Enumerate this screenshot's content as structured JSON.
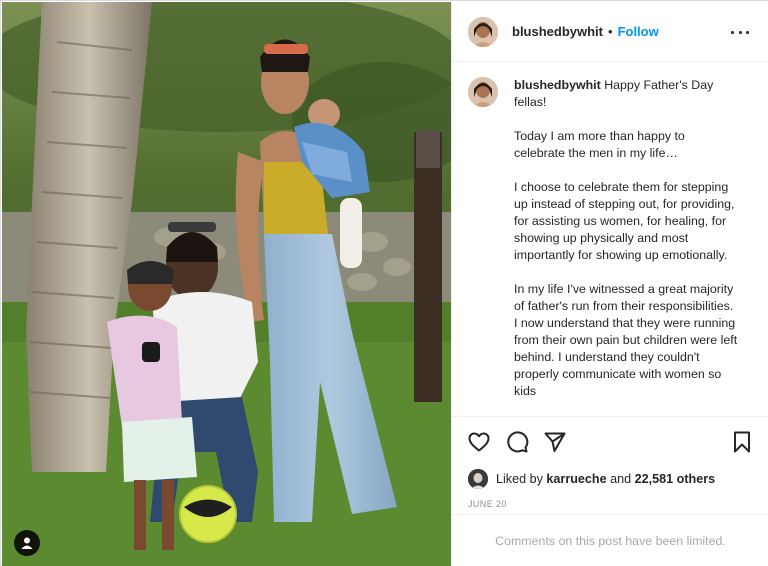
{
  "post": {
    "username": "blushedbywhit",
    "separator": "•",
    "follow_label": "Follow",
    "more_options": "more-horizontal-icon"
  },
  "caption": {
    "username": "blushedbywhit",
    "paragraphs": [
      "Happy Father's Day fellas!",
      "Today I am more than happy to celebrate the men in my life…",
      "I choose to celebrate them for stepping up instead of stepping out, for providing, for assisting us women, for healing, for showing up physically and most importantly for showing up emotionally.",
      "In my life I've witnessed a great majority of father's run from their responsibilities. I now understand that they were running from their own pain but children were left behind. I understand they couldn't properly communicate with women so kids"
    ]
  },
  "actions": {
    "like_icon": "heart-icon",
    "comment_icon": "comment-icon",
    "share_icon": "send-icon",
    "save_icon": "bookmark-icon"
  },
  "likes": {
    "prefix": "Liked by",
    "liker": "karrueche",
    "connector": "and",
    "others": "22,581 others"
  },
  "date": "June 20",
  "comments_notice": "Comments on this post have been limited.",
  "colors": {
    "accent": "#0095f6",
    "text": "#262626",
    "muted": "#8e8e8e",
    "divider": "#efefef"
  }
}
